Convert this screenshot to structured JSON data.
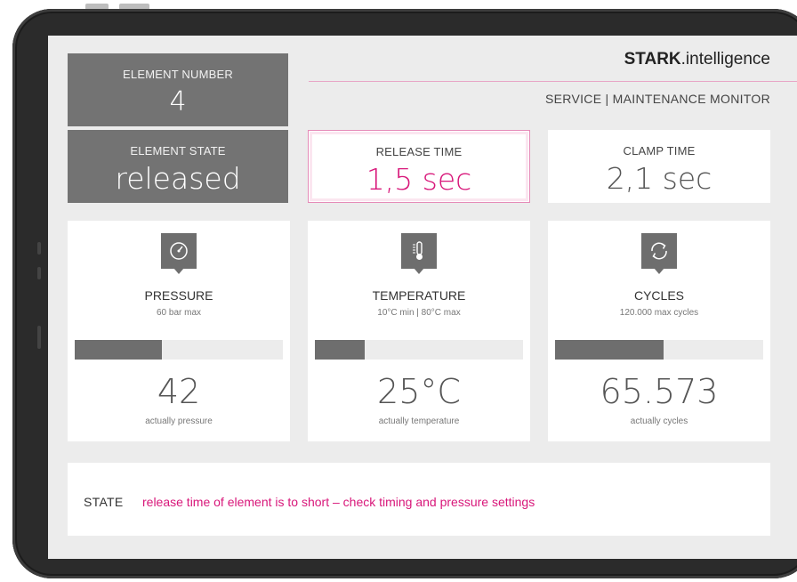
{
  "header": {
    "brand_bold": "STARK",
    "brand_light": ".intelligence",
    "subtitle": "SERVICE | MAINTENANCE MONITOR"
  },
  "element_number": {
    "label": "ELEMENT NUMBER",
    "value": "4"
  },
  "element_state": {
    "label": "ELEMENT STATE",
    "value": "released"
  },
  "release_time": {
    "label": "RELEASE TIME",
    "value": "1,5 sec"
  },
  "clamp_time": {
    "label": "CLAMP TIME",
    "value": "2,1 sec"
  },
  "metrics": [
    {
      "title": "PRESSURE",
      "subtitle": "60 bar max",
      "value": "42",
      "caption": "actually pressure",
      "icon": "gauge-icon",
      "fill_fraction": 0.42
    },
    {
      "title": "TEMPERATURE",
      "subtitle": "10°C min | 80°C max",
      "value": "25°C",
      "caption": "actually temperature",
      "icon": "thermometer-icon",
      "fill_fraction": 0.24
    },
    {
      "title": "CYCLES",
      "subtitle": "120.000 max cycles",
      "value": "65.573",
      "caption": "actually cycles",
      "icon": "cycle-icon",
      "fill_fraction": 0.52
    }
  ],
  "state": {
    "label": "STATE",
    "message": "release time of element is to short – check timing and pressure settings"
  },
  "colors": {
    "accent": "#d8177a",
    "tile_dark": "#737373",
    "background": "#ececec"
  }
}
